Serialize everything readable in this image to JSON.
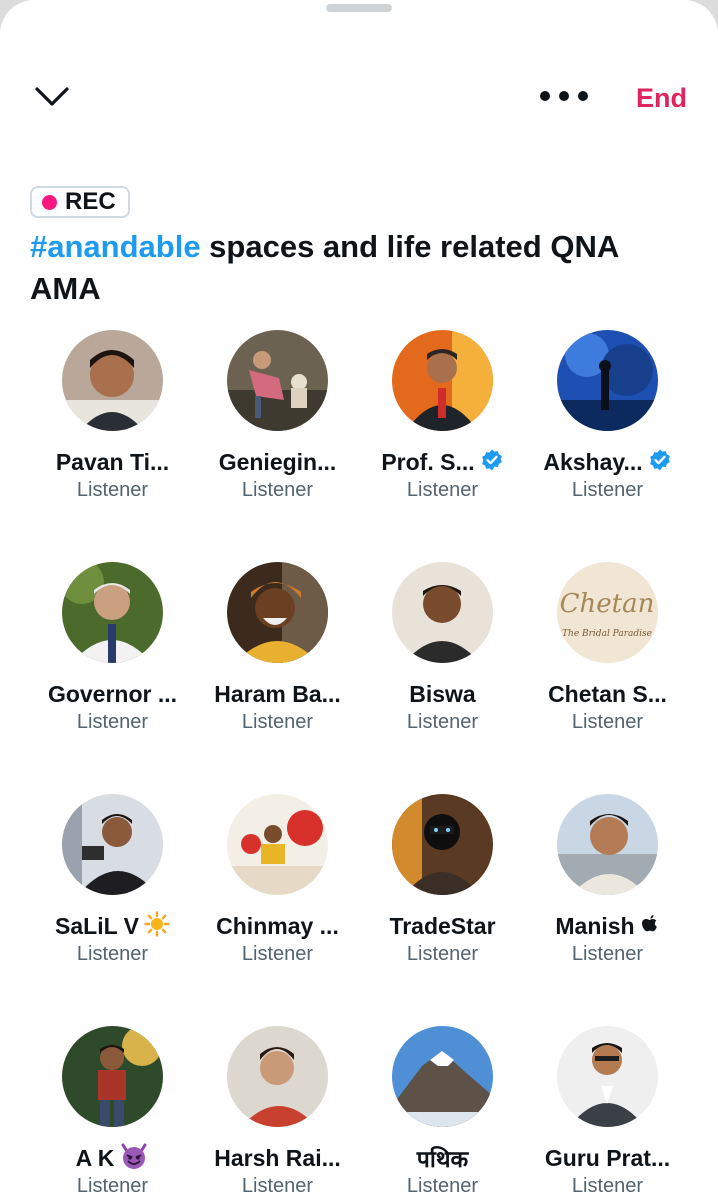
{
  "header": {
    "end_label": "End"
  },
  "space": {
    "rec_label": "REC",
    "hashtag": "#anandable",
    "title_rest": " spaces and life related QNA AMA"
  },
  "colors": {
    "accent": "#1d9bf0",
    "end": "#e0245e",
    "rec": "#f91880"
  },
  "participants": [
    {
      "name": "Pavan Ti...",
      "role": "Listener",
      "badge": null
    },
    {
      "name": "Geniegin...",
      "role": "Listener",
      "badge": null
    },
    {
      "name": "Prof. S...",
      "role": "Listener",
      "badge": "verified-badge-icon"
    },
    {
      "name": "Akshay...",
      "role": "Listener",
      "badge": "verified-badge-icon"
    },
    {
      "name": "Governor ...",
      "role": "Listener",
      "badge": null
    },
    {
      "name": "Haram Ba...",
      "role": "Listener",
      "badge": null
    },
    {
      "name": "Biswa",
      "role": "Listener",
      "badge": null
    },
    {
      "name": "Chetan S...",
      "role": "Listener",
      "badge": null
    },
    {
      "name": "SaLiL V",
      "role": "Listener",
      "badge": "sun-emoji-icon"
    },
    {
      "name": "Chinmay ...",
      "role": "Listener",
      "badge": null
    },
    {
      "name": "TradeStar",
      "role": "Listener",
      "badge": null
    },
    {
      "name": "Manish",
      "role": "Listener",
      "badge": "apple-icon"
    },
    {
      "name": "A K",
      "role": "Listener",
      "badge": "devil-emoji-icon"
    },
    {
      "name": "Harsh Rai...",
      "role": "Listener",
      "badge": null
    },
    {
      "name": "पथिक",
      "role": "Listener",
      "badge": null
    },
    {
      "name": "Guru Prat...",
      "role": "Listener",
      "badge": null
    }
  ]
}
